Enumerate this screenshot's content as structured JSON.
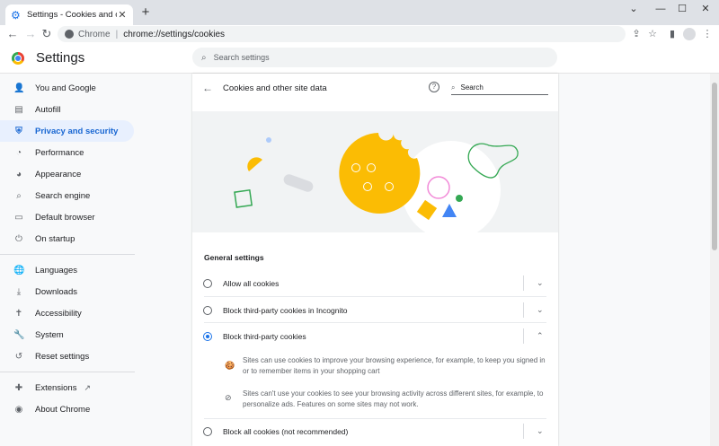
{
  "browser": {
    "tab_title": "Settings - Cookies and other site",
    "tab_close": "✕",
    "new_tab": "+",
    "omnibox_scheme": "Chrome",
    "omnibox_url": "chrome://settings/cookies"
  },
  "header": {
    "title": "Settings",
    "search_placeholder": "Search settings"
  },
  "sidebar": {
    "items": [
      {
        "label": "You and Google",
        "icon": "person-icon"
      },
      {
        "label": "Autofill",
        "icon": "clipboard-icon"
      },
      {
        "label": "Privacy and security",
        "icon": "shield-icon"
      },
      {
        "label": "Performance",
        "icon": "speedometer-icon"
      },
      {
        "label": "Appearance",
        "icon": "palette-icon"
      },
      {
        "label": "Search engine",
        "icon": "search-icon"
      },
      {
        "label": "Default browser",
        "icon": "browser-icon"
      },
      {
        "label": "On startup",
        "icon": "power-icon"
      },
      {
        "label": "Languages",
        "icon": "globe-icon"
      },
      {
        "label": "Downloads",
        "icon": "download-icon"
      },
      {
        "label": "Accessibility",
        "icon": "accessibility-icon"
      },
      {
        "label": "System",
        "icon": "wrench-icon"
      },
      {
        "label": "Reset settings",
        "icon": "history-icon"
      },
      {
        "label": "Extensions",
        "icon": "puzzle-icon"
      },
      {
        "label": "About Chrome",
        "icon": "chrome-icon"
      }
    ]
  },
  "card": {
    "title": "Cookies and other site data",
    "search_placeholder": "Search",
    "section_title": "General settings",
    "options": [
      {
        "label": "Allow all cookies",
        "checked": false,
        "expanded": false
      },
      {
        "label": "Block third-party cookies in Incognito",
        "checked": false,
        "expanded": false
      },
      {
        "label": "Block third-party cookies",
        "checked": true,
        "expanded": true
      },
      {
        "label": "Block all cookies (not recommended)",
        "checked": false,
        "expanded": false
      }
    ],
    "details": [
      "Sites can use cookies to improve your browsing experience, for example, to keep you signed in or to remember items in your shopping cart",
      "Sites can't use your cookies to see your browsing activity across different sites, for example, to personalize ads. Features on some sites may not work."
    ]
  },
  "colors": {
    "accent": "#1a73e8",
    "active_bg": "#e8f0fe",
    "cookie_yellow": "#fbbc04",
    "shape_green": "#34a853",
    "shape_pink": "#f28bd8",
    "shape_blue": "#4285f4"
  }
}
